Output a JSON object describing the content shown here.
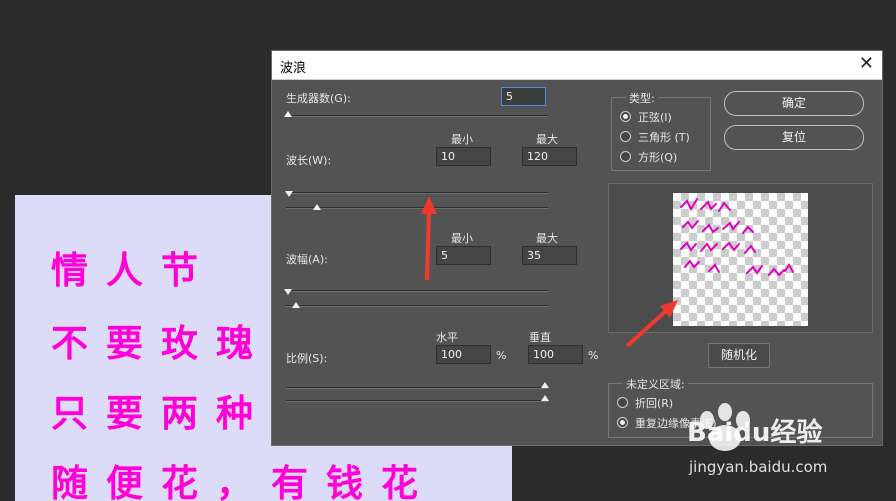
{
  "canvas": {
    "lines": [
      "情人节",
      "不要玫瑰",
      "只要两种",
      "随便花，有钱花"
    ]
  },
  "dialog": {
    "title": "波浪",
    "close_glyph": "✕",
    "generators": {
      "label": "生成器数(G):",
      "value": "5"
    },
    "wavelength": {
      "label": "波长(W):",
      "min_label": "最小",
      "max_label": "最大",
      "min": "10",
      "max": "120"
    },
    "amplitude": {
      "label": "波幅(A):",
      "min_label": "最小",
      "max_label": "最大",
      "min": "5",
      "max": "35"
    },
    "scale": {
      "label": "比例(S):",
      "h_label": "水平",
      "v_label": "垂直",
      "h": "100",
      "v": "100",
      "unit": "%"
    },
    "type_group": {
      "title": "类型:",
      "options": [
        "正弦(I)",
        "三角形 (T)",
        "方形(Q)"
      ],
      "selected": "正弦(I)"
    },
    "ok_button": "确定",
    "reset_button": "复位",
    "randomize_button": "随机化",
    "undefined_area": {
      "title": "未定义区域:",
      "options": [
        "折回(R)",
        "重复边缘像素(E)"
      ],
      "selected": "重复边缘像素(E)"
    }
  },
  "watermark": {
    "brand": "Baidu经验",
    "url": "jingyan.baidu.com"
  },
  "colors": {
    "accent": "#ff00d8",
    "annotation": "#ee3a2e",
    "dialog_bg": "#535353"
  }
}
